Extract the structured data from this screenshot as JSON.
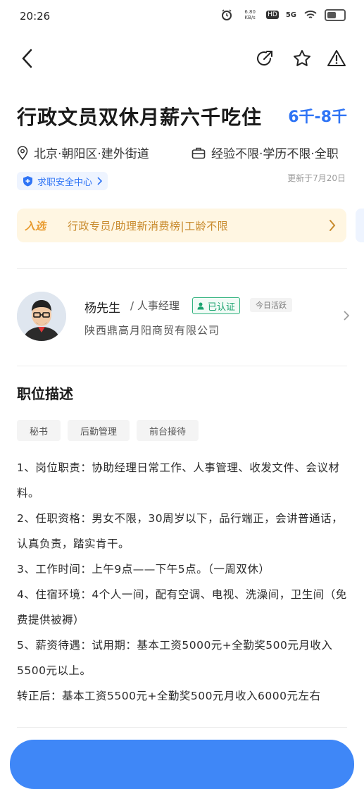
{
  "status_bar": {
    "time": "20:26",
    "net_speed": "6.80 KB/s",
    "hd": "HD",
    "signal": "5G"
  },
  "nav": {
    "icons": [
      "back-icon",
      "share-icon",
      "star-icon",
      "warning-icon"
    ]
  },
  "job": {
    "title": "行政文员双休月薪六千吃住",
    "salary": "6千-8千",
    "location": "北京·朝阳区·建外街道",
    "requirements": "经验不限·学历不限·全职",
    "safety_label": "求职安全中心",
    "updated": "更新于7月20日"
  },
  "banner": {
    "logo": "入选",
    "text": "行政专员/助理新消费榜|工龄不限"
  },
  "recruiter": {
    "name": "杨先生",
    "role": "/ 人事经理",
    "verified": "已认证",
    "active": "今日活跃",
    "company": "陕西鼎高月阳商贸有限公司"
  },
  "description": {
    "title": "职位描述",
    "tags": [
      "秘书",
      "后勤管理",
      "前台接待"
    ],
    "lines": [
      "1、岗位职责：协助经理日常工作、人事管理、收发文件、会议材料。",
      "2、任职资格：男女不限，30周岁以下，品行端正，会讲普通话，认真负责，踏实肯干。",
      "3、工作时间：上午9点——下午5点。（一周双休）",
      "4、住宿环境：4个人一间，配有空调、电视、洗澡间，卫生间（免费提供被褥）",
      "5、薪资待遇：试用期：基本工资5000元+全勤奖500元月收入5500元以上。",
      "转正后：基本工资5500元+全勤奖500元月收入6000元左右"
    ]
  },
  "colors": {
    "accent": "#2f74f5",
    "banner_bg": "#fff6e2",
    "banner_text": "#c88a2c",
    "verified": "#1aa36f",
    "apply_button": "#3f87f7"
  }
}
